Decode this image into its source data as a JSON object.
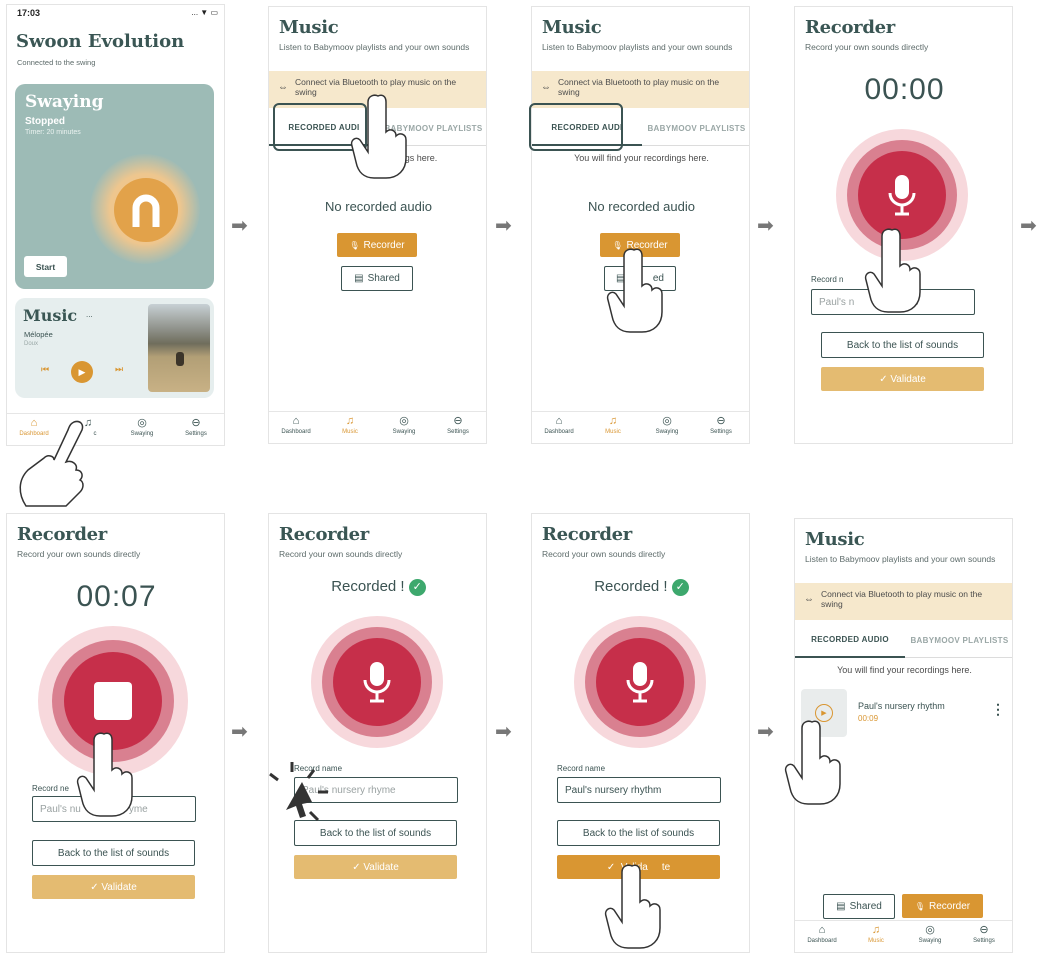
{
  "nav": [
    {
      "label": "Dashboard",
      "icon": "⌂"
    },
    {
      "label": "Music",
      "icon": "♫"
    },
    {
      "label": "Swaying",
      "icon": "◎"
    },
    {
      "label": "Settings",
      "icon": "⊖"
    }
  ],
  "arrow_glyph": "➡",
  "screen1": {
    "status_time": "17:03",
    "status_icons": "... ▼ ▭",
    "app_title": "Swoon Evolution",
    "connected": "Connected to the swing",
    "sway": {
      "title": "Swaying",
      "status": "Stopped",
      "timer": "Timer: 20 minutes",
      "start": "Start"
    },
    "music": {
      "title": "Music",
      "dots": "...",
      "track": "Mélopée",
      "sub": "Doux",
      "prev": "⏮",
      "play": "▶",
      "next": "⏭"
    },
    "nav_music_partial": "c"
  },
  "music_page": {
    "title": "Music",
    "subtitle": "Listen to Babymoov playlists and your own sounds",
    "banner": "Connect via Bluetooth to play music on the swing",
    "tab_recorded": "RECORDED AUDIO",
    "tab_recorded_clipped": "RECORDED AUDI",
    "tab_playlists": "BABYMOOV PLAYLISTS",
    "hint": "You will find your recordings here.",
    "hint_clipped": "rdings here.",
    "empty": "No recorded audio",
    "recorder_btn": "Recorder",
    "shared_btn": "Shared",
    "shared_clipped": "Sh    ed",
    "mic_glyph": "🎙",
    "doc_glyph": "▤"
  },
  "recorder_page": {
    "title": "Recorder",
    "subtitle": "Record your own sounds directly",
    "timer_start": "00:00",
    "timer_running": "00:07",
    "recorded": "Recorded !",
    "check": "✓",
    "record_name_label": "Record name",
    "record_name_clipped": "Record n",
    "record_name_clipped2": "Record ne",
    "placeholder": "Paul's nursery rhyme",
    "placeholder_p1": "Paul's n",
    "placeholder_p2": "hyme",
    "placeholder_p3": "Paul's nu",
    "placeholder_p4": "yme",
    "value": "Paul's nursery rhythm",
    "back": "Back to the list of sounds",
    "validate": "✓  Validate",
    "validate_clipped": "✓  Valida",
    "validate_tail": "te"
  },
  "final_item": {
    "name": "Paul's nursery rhythm",
    "duration": "00:09",
    "menu": "⋮"
  }
}
